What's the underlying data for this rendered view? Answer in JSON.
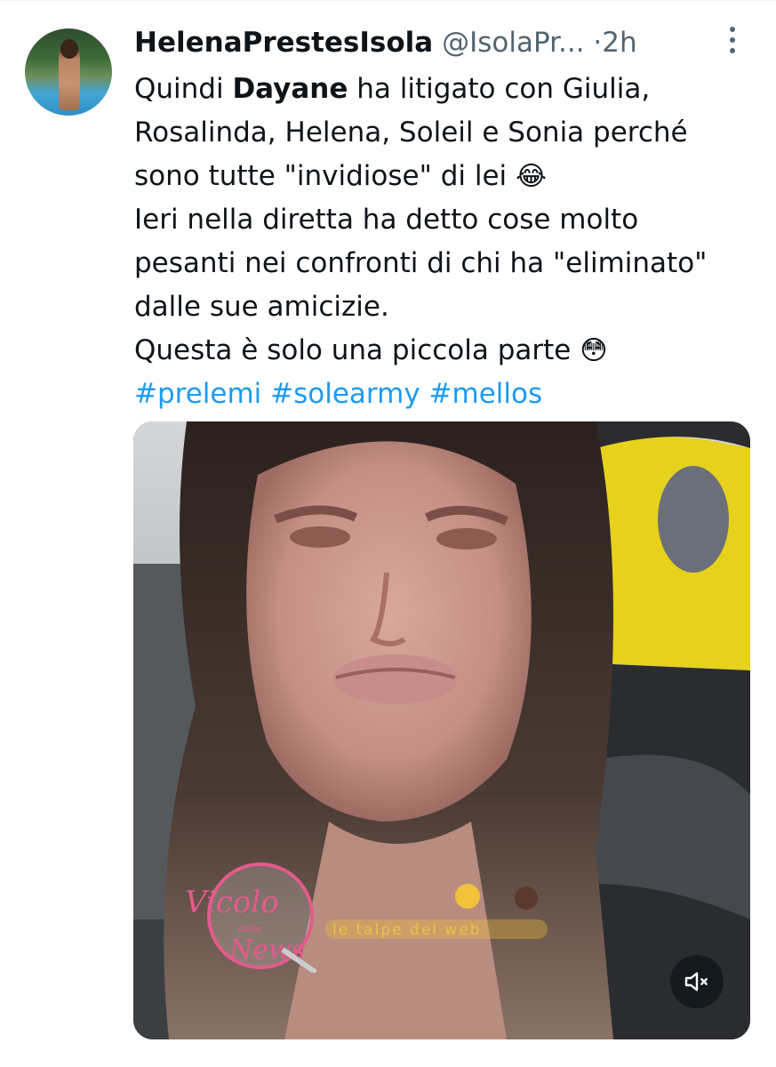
{
  "tweet": {
    "author_name": "HelenaPrestesIsola",
    "author_handle": "@IsolaPr...",
    "separator": "·",
    "time": "2h",
    "text_lines": [
      {
        "before": "Quindi ",
        "bold": "Dayane",
        "after": " ha litigato con Giulia,"
      },
      {
        "text": "Rosalinda, Helena, Soleil e Sonia perché"
      },
      {
        "text": "sono tutte \"invidiose\" di lei ",
        "emoji": "😂"
      },
      {
        "text": "Ieri nella diretta ha detto cose molto"
      },
      {
        "text": "pesanti nei confronti di chi ha \"eliminato\""
      },
      {
        "text": "dalle sue amicizie."
      },
      {
        "text": "Questa è solo una piccola parte ",
        "emoji": "😳"
      }
    ],
    "hashtags": [
      "#prelemi",
      "#solearmy",
      "#mellos"
    ]
  },
  "media": {
    "type": "video",
    "watermark_1": "Vicolo delle News",
    "watermark_2": "le talpe del web"
  },
  "icons": {
    "more": "more-options-icon",
    "mute": "volume-muted-icon"
  },
  "colors": {
    "text": "#0f1419",
    "secondary": "#536471",
    "link": "#1d9bf0"
  }
}
